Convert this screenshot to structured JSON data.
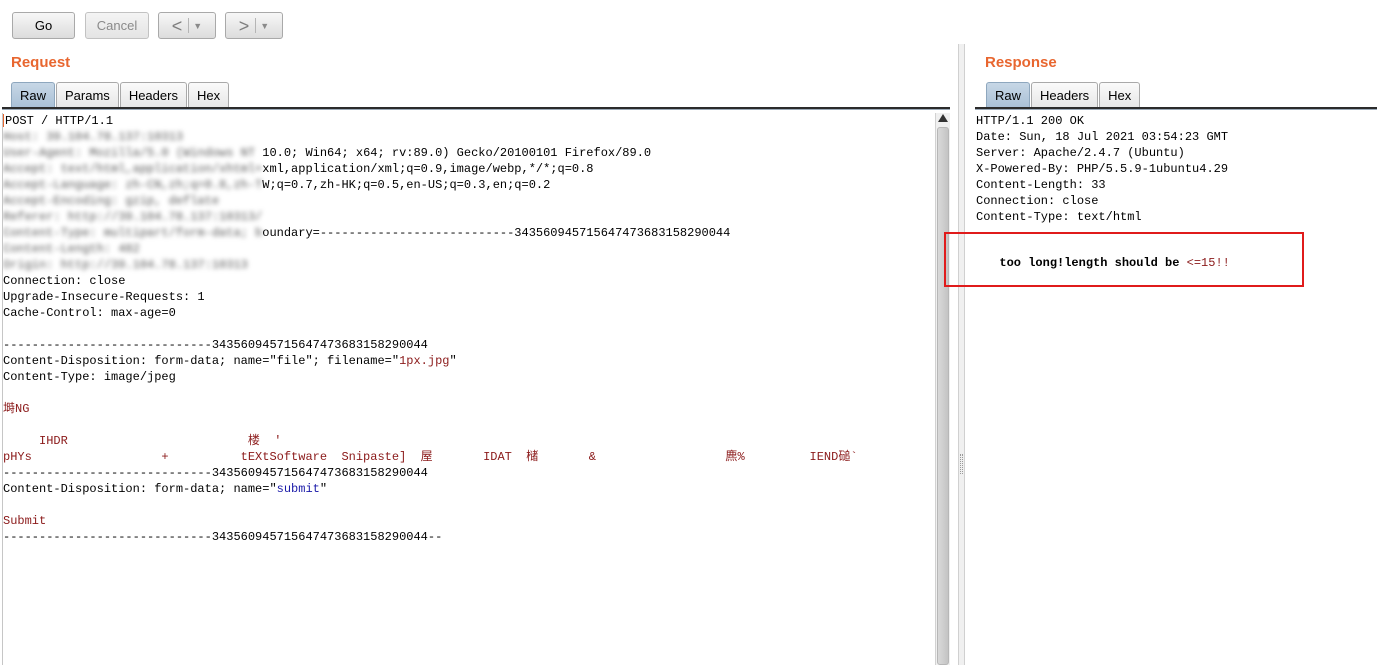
{
  "toolbar": {
    "go_label": "Go",
    "cancel_label": "Cancel",
    "back_arrow": "<",
    "forward_arrow": ">",
    "dropdown_caret": "▼"
  },
  "request": {
    "title": "Request",
    "tabs": [
      "Raw",
      "Params",
      "Headers",
      "Hex"
    ],
    "active_tab": "Raw",
    "lines": [
      {
        "plain": "POST / HTTP/1.1"
      },
      {
        "blurred": "Host: 39.104.78.137:10313"
      },
      {
        "blurred": "User-Agent: Mozilla/5.0 (Windows NT ",
        "plain": "10.0; Win64; x64; rv:89.0) Gecko/20100101 Firefox/89.0"
      },
      {
        "blurred": "Accept: text/html,application/xhtml+",
        "plain": "xml,application/xml;q=0.9,image/webp,*/*;q=0.8"
      },
      {
        "blurred": "Accept-Language: zh-CN,zh;q=0.8,zh-T",
        "plain": "W;q=0.7,zh-HK;q=0.5,en-US;q=0.3,en;q=0.2"
      },
      {
        "blurred": "Accept-Encoding: gzip, deflate"
      },
      {
        "blurred": "Referer: http://39.104.78.137:10313/"
      },
      {
        "blurred": "Content-Type: multipart/form-data; b",
        "plain": "oundary=---------------------------343560945715647473683158290044"
      },
      {
        "blurred": "Content-Length: 482"
      },
      {
        "blurred": "Origin: http://39.104.78.137:10313"
      },
      {
        "plain": "Connection: close"
      },
      {
        "plain": "Upgrade-Insecure-Requests: 1"
      },
      {
        "plain": "Cache-Control: max-age=0"
      },
      {
        "plain": ""
      },
      {
        "plain": "-----------------------------343560945715647473683158290044"
      },
      {
        "plain": "Content-Disposition: form-data; name=\"file\"; filename=\"",
        "red": "1px.jpg",
        "plain2": "\""
      },
      {
        "plain": "Content-Type: image/jpeg"
      },
      {
        "plain": ""
      },
      {
        "red": "塒NG"
      },
      {
        "plain": ""
      },
      {
        "red": "     IHDR                         楼  '"
      },
      {
        "red": "pHYs                  +          tEXtSoftware  Snipaste]  屋       IDAT  槠       &                  麃%         IEND磓`"
      },
      {
        "plain": "-----------------------------343560945715647473683158290044"
      },
      {
        "plain": "Content-Disposition: form-data; name=\"",
        "blue": "submit",
        "plain2": "\""
      },
      {
        "plain": ""
      },
      {
        "red": "Submit"
      },
      {
        "plain": "-----------------------------343560945715647473683158290044--"
      }
    ]
  },
  "response": {
    "title": "Response",
    "tabs": [
      "Raw",
      "Headers",
      "Hex"
    ],
    "active_tab": "Raw",
    "headers": [
      "HTTP/1.1 200 OK",
      "Date: Sun, 18 Jul 2021 03:54:23 GMT",
      "Server: Apache/2.4.7 (Ubuntu)",
      "X-Powered-By: PHP/5.5.9-1ubuntu4.29",
      "Content-Length: 33",
      "Connection: close",
      "Content-Type: text/html"
    ],
    "body_bold": "too long!length should be ",
    "body_rest": "<=15!!"
  },
  "colors": {
    "title_orange": "#e8662f",
    "highlight_red": "#e01b1b",
    "tab_active": "#a9c0d6"
  }
}
